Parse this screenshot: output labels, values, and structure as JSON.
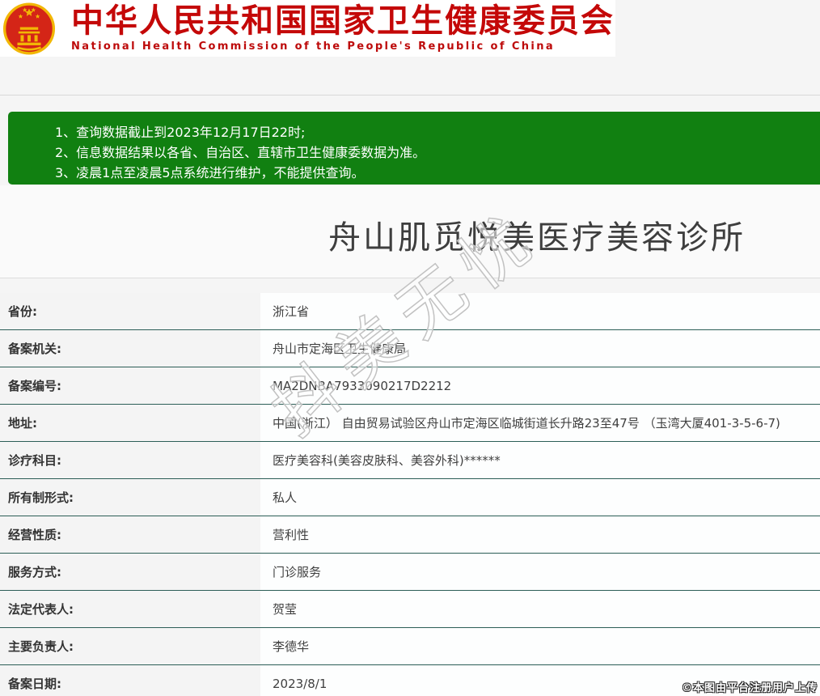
{
  "header": {
    "emblem_icon": "china-national-emblem-icon",
    "title_cn": "中华人民共和国国家卫生健康委员会",
    "title_en": "National Health Commission of the People's Republic of China"
  },
  "notice": {
    "lines": [
      "1、查询数据截止到2023年12月17日22时;",
      "2、信息数据结果以各省、自治区、直辖市卫生健康委数据为准。",
      "3、凌晨1点至凌晨5点系统进行维护，不能提供查询。"
    ]
  },
  "record": {
    "title": "舟山肌觅悦美医疗美容诊所",
    "rows": [
      {
        "label": "省份:",
        "value": "浙江省"
      },
      {
        "label": "备案机关:",
        "value": "舟山市定海区卫生健康局"
      },
      {
        "label": "备案编号:",
        "value": "MA2DNBA7933090217D2212"
      },
      {
        "label": "地址:",
        "value": "中国(浙江） 自由贸易试验区舟山市定海区临城街道长升路23至47号 （玉湾大厦401-3-5-6-7)"
      },
      {
        "label": "诊疗科目:",
        "value": "医疗美容科(美容皮肤科、美容外科)******"
      },
      {
        "label": "所有制形式:",
        "value": "私人"
      },
      {
        "label": "经营性质:",
        "value": "营利性"
      },
      {
        "label": "服务方式:",
        "value": "门诊服务"
      },
      {
        "label": "法定代表人:",
        "value": "贺莹"
      },
      {
        "label": "主要负责人:",
        "value": "李德华"
      },
      {
        "label": "备案日期:",
        "value": "2023/8/1"
      }
    ]
  },
  "watermark": {
    "text": "抖美无忧"
  },
  "credit": "©本图由平台注册用户上传",
  "colors": {
    "brand_red": "#c40808",
    "notice_green": "#118011",
    "row_divider_teal": "#2c5e57",
    "label_cell_bg": "#f4f4f4",
    "page_bg": "#f5f5f5"
  }
}
